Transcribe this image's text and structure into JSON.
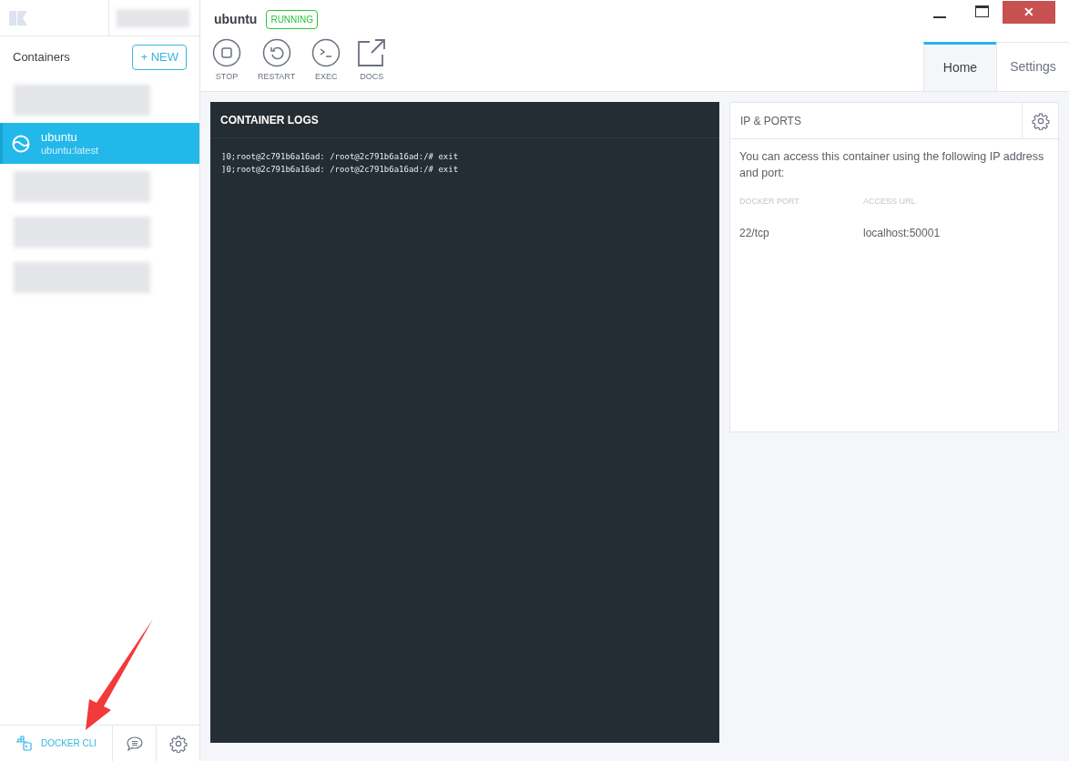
{
  "sidebar": {
    "heading": "Containers",
    "new_button": "+ NEW",
    "items": [
      {
        "kind": "redacted"
      },
      {
        "kind": "container",
        "name": "ubuntu",
        "image": "ubuntu:latest",
        "selected": true
      },
      {
        "kind": "redacted"
      },
      {
        "kind": "redacted"
      },
      {
        "kind": "redacted"
      }
    ],
    "footer": {
      "cli_label": "DOCKER CLI"
    }
  },
  "window": {
    "close_glyph": "✕"
  },
  "container": {
    "name": "ubuntu",
    "status": "RUNNING"
  },
  "actions": [
    {
      "kind": "stop",
      "label": "STOP"
    },
    {
      "kind": "restart",
      "label": "RESTART"
    },
    {
      "kind": "exec",
      "label": "EXEC"
    },
    {
      "kind": "docs",
      "label": "DOCS"
    }
  ],
  "tabs": [
    {
      "label": "Home",
      "selected": true
    },
    {
      "label": "Settings",
      "selected": false
    }
  ],
  "logs": {
    "title": "CONTAINER LOGS",
    "lines": [
      "]0;root@2c791b6a16ad: /root@2c791b6a16ad:/# exit",
      "]0;root@2c791b6a16ad: /root@2c791b6a16ad:/# exit"
    ]
  },
  "ports": {
    "title": "IP & PORTS",
    "description": "You can access this container using the following IP address and port:",
    "columns": [
      "DOCKER PORT",
      "ACCESS URL"
    ],
    "rows": [
      [
        "22/tcp",
        "localhost:50001"
      ]
    ]
  }
}
